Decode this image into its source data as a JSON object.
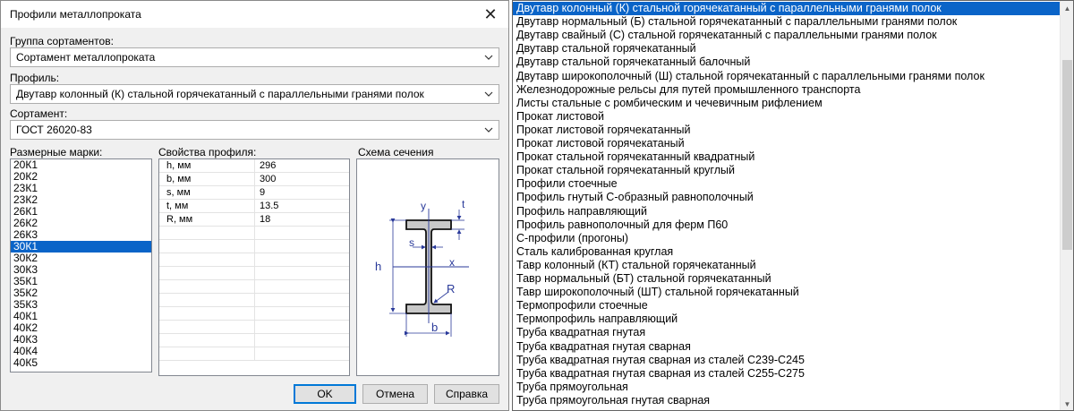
{
  "dialog": {
    "title": "Профили металлопроката",
    "close_label": "✕",
    "group": {
      "label": "Группа сортаментов:",
      "value": "Сортамент металлопроката"
    },
    "profile": {
      "label": "Профиль:",
      "value": "Двутавр колонный (К) стальной горячекатанный с параллельными гранями полок"
    },
    "assortment": {
      "label": "Сортамент:",
      "value": "ГОСТ 26020-83"
    },
    "marks": {
      "label": "Размерные марки:",
      "selected": "30К1",
      "items": [
        "20К1",
        "20К2",
        "23К1",
        "23К2",
        "26К1",
        "26К2",
        "26К3",
        "30К1",
        "30К2",
        "30К3",
        "35К1",
        "35К2",
        "35К3",
        "40К1",
        "40К2",
        "40К3",
        "40К4",
        "40К5"
      ]
    },
    "properties": {
      "label": "Свойства профиля:",
      "rows": [
        {
          "name": "h, мм",
          "value": "296"
        },
        {
          "name": "b, мм",
          "value": "300"
        },
        {
          "name": "s, мм",
          "value": "9"
        },
        {
          "name": "t, мм",
          "value": "13.5"
        },
        {
          "name": "R, мм",
          "value": "18"
        }
      ]
    },
    "schema": {
      "label": "Схема сечения",
      "labels": {
        "y": "y",
        "t": "t",
        "s": "s",
        "h": "h",
        "x": "x",
        "R": "R",
        "b": "b"
      }
    },
    "buttons": {
      "ok": "OK",
      "cancel": "Отмена",
      "help": "Справка"
    }
  },
  "dropdown": {
    "selected_index": 0,
    "items": [
      "Двутавр колонный (К) стальной горячекатанный с параллельными гранями полок",
      "Двутавр нормальный (Б) стальной горячекатанный с параллельными гранями полок",
      "Двутавр свайный (С) стальной горячекатанный с параллельными гранями полок",
      "Двутавр стальной горячекатанный",
      "Двутавр стальной горячекатанный балочный",
      "Двутавр широкополочный (Ш) стальной горячекатанный с параллельными гранями полок",
      "Железнодорожные рельсы для путей промышленного транспорта",
      "Листы стальные с ромбическим и чечевичным рифлением",
      "Прокат листовой",
      "Прокат листовой горячекатанный",
      "Прокат листовой горячекатаный",
      "Прокат стальной горячекатанный квадратный",
      "Прокат стальной горячекатанный круглый",
      "Профили стоечные",
      "Профиль гнутый С-образный равнополочный",
      "Профиль направляющий",
      "Профиль равнополочный для ферм П60",
      "С-профили (прогоны)",
      "Сталь калиброванная круглая",
      "Тавр колонный (КТ) стальной горячекатанный",
      "Тавр нормальный (БТ) стальной горячекатанный",
      "Тавр широкополочный (ШТ) стальной горячекатанный",
      "Термопрофили стоечные",
      "Термопрофиль направляющий",
      "Труба квадратная гнутая",
      "Труба квадратная гнутая сварная",
      "Труба квадратная гнутая сварная из сталей С239-С245",
      "Труба квадратная гнутая сварная из сталей С255-С275",
      "Труба прямоугольная",
      "Труба прямоугольная гнутая сварная"
    ],
    "scroll": {
      "up_icon": "▲",
      "down_icon": "▼"
    }
  },
  "colors": {
    "selection": "#0a64c8",
    "dim_line": "#2a3a9a",
    "dialog_bg": "#f0f0f0"
  }
}
